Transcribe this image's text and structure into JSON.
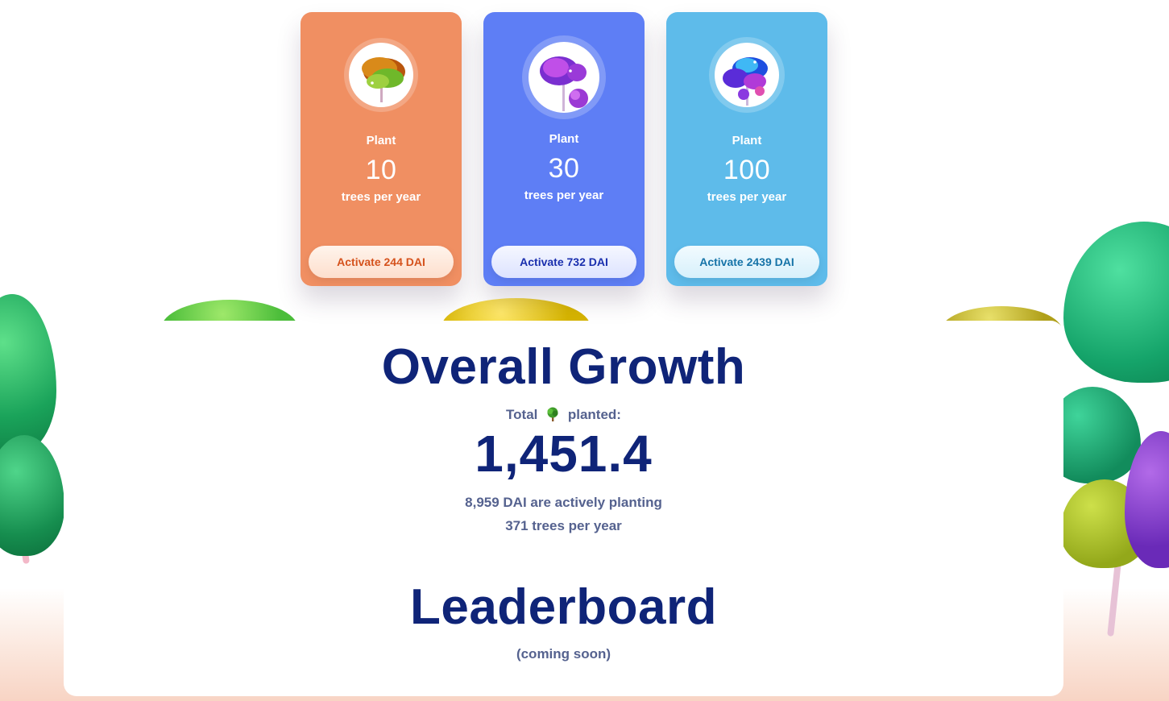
{
  "plans": [
    {
      "label": "Plant",
      "count": "10",
      "unit": "trees per year",
      "button": "Activate 244 DAI",
      "icon": "green-tree-icon",
      "color": "#f08f62"
    },
    {
      "label": "Plant",
      "count": "30",
      "unit": "trees per year",
      "button": "Activate 732 DAI",
      "icon": "purple-tree-icon",
      "color": "#5e7ef5"
    },
    {
      "label": "Plant",
      "count": "100",
      "unit": "trees per year",
      "button": "Activate 2439 DAI",
      "icon": "blue-tree-icon",
      "color": "#5ebbea"
    }
  ],
  "growth": {
    "title": "Overall Growth",
    "total_prefix": "Total",
    "total_icon": "deciduous-tree-emoji-icon",
    "total_suffix": "planted:",
    "total_value": "1,451.4",
    "dai_line": "8,959 DAI are actively planting",
    "trees_line": "371 trees per year"
  },
  "leaderboard": {
    "title": "Leaderboard",
    "note": "(coming soon)"
  },
  "colors": {
    "heading": "#0f2478",
    "muted": "#55628f"
  }
}
